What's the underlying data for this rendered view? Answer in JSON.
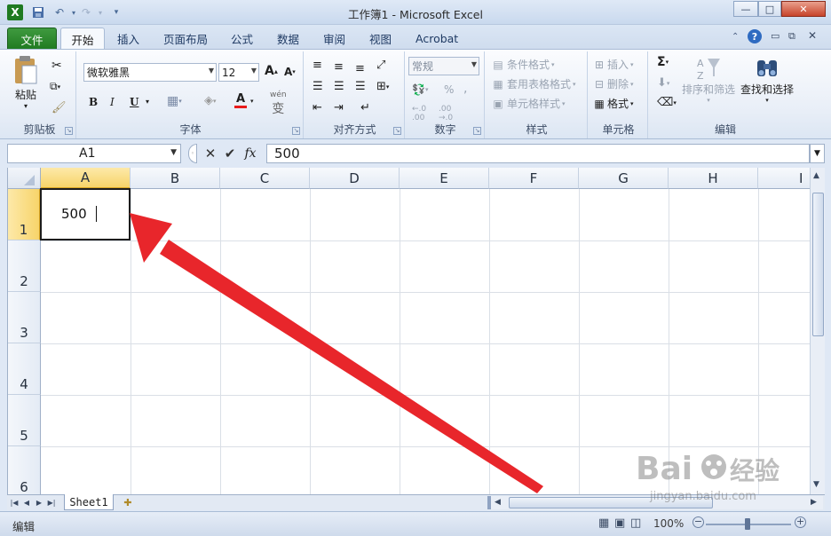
{
  "window": {
    "title": "工作簿1  -  Microsoft Excel",
    "controls": [
      "minimize",
      "maximize",
      "close"
    ]
  },
  "quick_access": {
    "icons": [
      "excel-logo-icon",
      "save-icon",
      "undo-icon",
      "redo-icon",
      "customize-icon"
    ]
  },
  "tabs": {
    "file": "文件",
    "home": "开始",
    "insert": "插入",
    "page_layout": "页面布局",
    "formulas": "公式",
    "data": "数据",
    "review": "审阅",
    "view": "视图",
    "acrobat": "Acrobat"
  },
  "ribbon": {
    "clipboard": {
      "paste": "粘贴",
      "label": "剪贴板"
    },
    "font": {
      "font_name": "微软雅黑",
      "font_size": "12",
      "bold": "B",
      "italic": "I",
      "underline": "U",
      "wen": "wén",
      "label": "字体"
    },
    "alignment": {
      "label": "对齐方式"
    },
    "number": {
      "format": "常规",
      "percent": "%",
      "comma": ",",
      "label": "数字"
    },
    "styles": {
      "conditional": "条件格式",
      "table": "套用表格格式",
      "cell_styles": "单元格样式",
      "label": "样式"
    },
    "cells": {
      "insert": "插入",
      "delete": "删除",
      "format": "格式",
      "label": "单元格"
    },
    "editing": {
      "sort": "排序和筛选",
      "find": "查找和选择",
      "label": "编辑"
    }
  },
  "formula_bar": {
    "name_box": "A1",
    "fx": "fx",
    "content": "500"
  },
  "grid": {
    "columns": [
      "A",
      "B",
      "C",
      "D",
      "E",
      "F",
      "G",
      "H",
      "I"
    ],
    "rows": [
      "1",
      "2",
      "3",
      "4",
      "5",
      "6"
    ],
    "selected_cell": "A1",
    "cell_a1": "500"
  },
  "sheets": [
    "Sheet1"
  ],
  "status": {
    "mode": "编辑",
    "zoom": "100%"
  },
  "annotation": {
    "arrow_color": "#e8262b"
  },
  "watermark": {
    "brand": "Bai du 经验",
    "url": "jingyan.baidu.com"
  }
}
